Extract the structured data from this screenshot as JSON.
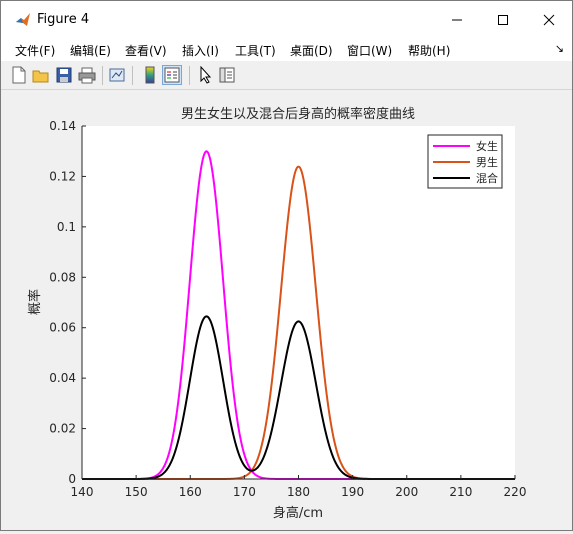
{
  "window": {
    "title": "Figure 4",
    "controls": {
      "minimize": "minimize",
      "maximize": "maximize",
      "close": "close"
    }
  },
  "menubar": {
    "items": [
      "文件(F)",
      "编辑(E)",
      "查看(V)",
      "插入(I)",
      "工具(T)",
      "桌面(D)",
      "窗口(W)",
      "帮助(H)"
    ],
    "overflow_glyph": "↘"
  },
  "toolbar": {
    "buttons": [
      "new-figure-icon",
      "open-file-icon",
      "save-icon",
      "print-icon",
      "link-plot-icon",
      "colorbar-icon",
      "legend-icon",
      "pointer-icon",
      "property-inspector-icon"
    ]
  },
  "chart_data": {
    "type": "line",
    "title": "男生女生以及混合后身高的概率密度曲线",
    "xlabel": "身高/cm",
    "ylabel": "概率",
    "xlim": [
      140,
      220
    ],
    "ylim": [
      0,
      0.14
    ],
    "xticks": [
      140,
      150,
      160,
      170,
      180,
      190,
      200,
      210,
      220
    ],
    "yticks": [
      0,
      0.02,
      0.04,
      0.06,
      0.08,
      0.1,
      0.12,
      0.14
    ],
    "ytick_labels": [
      "0",
      "0.02",
      "0.04",
      "0.06",
      "0.08",
      "0.1",
      "0.12",
      "0.14"
    ],
    "legend_position": "top-right",
    "grid": false,
    "series": [
      {
        "name": "女生",
        "color": "#ff00ff",
        "mu": 163,
        "sigma": 3.07,
        "weight": 1.0,
        "peak": 0.13
      },
      {
        "name": "男生",
        "color": "#d95319",
        "mu": 180,
        "sigma": 3.22,
        "weight": 1.0,
        "peak": 0.124
      },
      {
        "name": "混合",
        "color": "#000000",
        "peak_left": 0.0645,
        "peak_right": 0.0625
      }
    ]
  }
}
